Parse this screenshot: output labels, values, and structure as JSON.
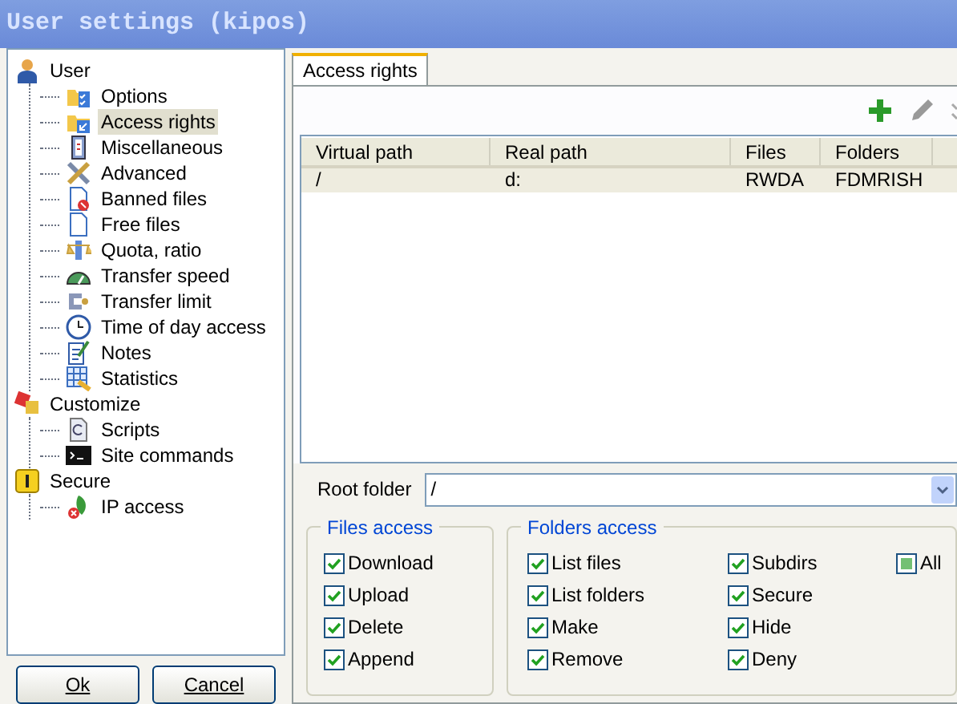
{
  "window": {
    "title": "User settings (kipos)"
  },
  "tree": [
    {
      "label": "User",
      "kind": "user",
      "selected": false,
      "children": [
        {
          "label": "Options",
          "kind": "options",
          "selected": false
        },
        {
          "label": "Access rights",
          "kind": "access",
          "selected": true
        },
        {
          "label": "Miscellaneous",
          "kind": "misc",
          "selected": false
        },
        {
          "label": "Advanced",
          "kind": "advanced",
          "selected": false
        },
        {
          "label": "Banned files",
          "kind": "banned",
          "selected": false
        },
        {
          "label": "Free files",
          "kind": "file",
          "selected": false
        },
        {
          "label": "Quota, ratio",
          "kind": "quota",
          "selected": false
        },
        {
          "label": "Transfer speed",
          "kind": "speed",
          "selected": false
        },
        {
          "label": "Transfer limit",
          "kind": "limit",
          "selected": false
        },
        {
          "label": "Time of day access",
          "kind": "clock",
          "selected": false
        },
        {
          "label": "Notes",
          "kind": "notes",
          "selected": false
        },
        {
          "label": "Statistics",
          "kind": "stats",
          "selected": false
        }
      ]
    },
    {
      "label": "Customize",
      "kind": "customize",
      "selected": false,
      "children": [
        {
          "label": "Scripts",
          "kind": "scripts",
          "selected": false
        },
        {
          "label": "Site commands",
          "kind": "console",
          "selected": false
        }
      ]
    },
    {
      "label": "Secure",
      "kind": "secure",
      "selected": false,
      "children": [
        {
          "label": "IP access",
          "kind": "ip",
          "selected": false
        }
      ]
    }
  ],
  "buttons": [
    "Ok",
    "Cancel"
  ],
  "tabs": [
    {
      "label": "Access rights",
      "selected": true
    }
  ],
  "table": {
    "columns": [
      "Virtual path",
      "Real path",
      "Files",
      "Folders"
    ],
    "rows": [
      {
        "cells": [
          "/",
          "d:",
          "RWDA",
          "FDMRISH"
        ],
        "selected": true
      }
    ]
  },
  "root_folder": {
    "label": "Root folder",
    "value": "/"
  },
  "files_access": {
    "title": "Files access",
    "options": [
      {
        "label": "Download",
        "checked": true,
        "indeterminate": false
      },
      {
        "label": "Upload",
        "checked": true,
        "indeterminate": false
      },
      {
        "label": "Delete",
        "checked": true,
        "indeterminate": false
      },
      {
        "label": "Append",
        "checked": true,
        "indeterminate": false
      }
    ]
  },
  "folders_access": {
    "title": "Folders access",
    "options": [
      {
        "label": "List files",
        "checked": true,
        "indeterminate": false
      },
      {
        "label": "List folders",
        "checked": true,
        "indeterminate": false
      },
      {
        "label": "Make",
        "checked": true,
        "indeterminate": false
      },
      {
        "label": "Remove",
        "checked": true,
        "indeterminate": false
      },
      {
        "label": "Subdirs",
        "checked": true,
        "indeterminate": false
      },
      {
        "label": "Secure",
        "checked": true,
        "indeterminate": false
      },
      {
        "label": "Hide",
        "checked": true,
        "indeterminate": false
      },
      {
        "label": "Deny",
        "checked": true,
        "indeterminate": false
      },
      {
        "label": "All",
        "checked": false,
        "indeterminate": true
      }
    ]
  }
}
